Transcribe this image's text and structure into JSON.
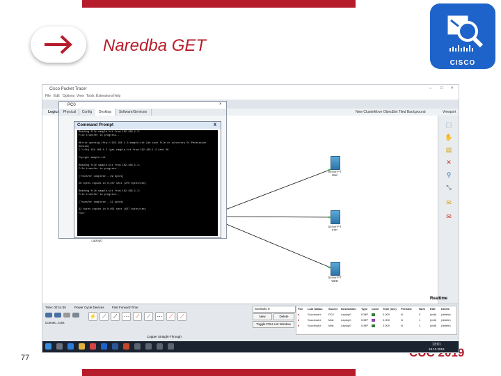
{
  "slide": {
    "title": "Naredba GET",
    "page_number": "77",
    "footer": "CUC 2019",
    "logo_text": "CISCO",
    "arrow_icon": "right-arrow-icon",
    "accent_color": "#b71c2b",
    "logo_color": "#1e63c9"
  },
  "app": {
    "title": "Cisco Packet Tracer",
    "window_controls": [
      "–",
      "□",
      "×"
    ],
    "menu": [
      "File",
      "Edit",
      "Options",
      "View",
      "Tools",
      "Extensions",
      "Help"
    ],
    "topbar_right": [
      "New Cluster",
      "Move Object",
      "Set Tiled Background",
      "Viewport"
    ],
    "logical_tab": "Logical",
    "realtime": "Realtime",
    "time_label": "Time: 00:14:40",
    "sim_controls": [
      "Power Cycle Devices",
      "Fast Forward Time"
    ],
    "bottom_left_btn": "PDU",
    "connection_label": "Connec...ions",
    "auto_connection": "Copper Straight-Through",
    "scenario": "Scenario 0",
    "pdu_buttons": [
      "New",
      "Delete",
      "Toggle PDU List Window"
    ]
  },
  "pc_window": {
    "title": "PC0",
    "tabs": [
      "Physical",
      "Config",
      "Desktop",
      "Software/Services"
    ]
  },
  "command_prompt": {
    "title": "Command Prompt",
    "close": "X",
    "lines": [
      "Reading file sample.txt from 192.168.1.2:",
      "File transfer in progress...",
      "",
      "%Error opening tftp://192.168.1.2/sample.txt (No such file or directory Or Permission",
      "denied)",
      "C:\\>ftp 192.168.1.2 /get sample.txt from 192.168.1.3 sent OK",
      "",
      "ftp>get sample.txt",
      "",
      "Reading file sample.txt from 192.168.1.3:",
      "File transfer in progress...",
      "",
      "[Transfer complete - 29 bytes]",
      "",
      "29 bytes copied in 0.107 secs (270 bytes/sec)",
      "",
      "Reading file sample.txt from 192.168.1.3:",
      "File transfer in progress...",
      "",
      "[Transfer complete - 32 bytes]",
      "",
      "32 bytes copied in 0.051 secs (627 bytes/sec)",
      "ftp>"
    ]
  },
  "devices": [
    {
      "label": "Server-PT\nMail"
    },
    {
      "label": "Server-PT\nFTP"
    },
    {
      "label": "Server-PT\nWEB"
    },
    {
      "label": "Laptop-PT\nLaptop0"
    }
  ],
  "pdu_list": {
    "headers": [
      "Fire",
      "Last Status",
      "Source",
      "Destination",
      "Type",
      "Color",
      "Time (sec)",
      "Periodic",
      "Num",
      "Edit",
      "Delete"
    ],
    "rows": [
      [
        "●",
        "Successful",
        "PC0",
        "Laptop0",
        "ICMP",
        "",
        "0.000",
        "N",
        "0",
        "(edit)",
        "(delete)"
      ],
      [
        "●",
        "Successful",
        "Mail",
        "Laptop0",
        "ICMP",
        "",
        "0.000",
        "N",
        "1",
        "(edit)",
        "(delete)"
      ],
      [
        "●",
        "Successful",
        "Mail",
        "Laptop0",
        "ICMP",
        "",
        "0.000",
        "N",
        "2",
        "(edit)",
        "(delete)"
      ]
    ],
    "row_colors": [
      "#2e7d32",
      "#8e44ad",
      "#2e7d32"
    ]
  },
  "taskbar": {
    "time": "13:01",
    "date": "19.12.2019"
  }
}
